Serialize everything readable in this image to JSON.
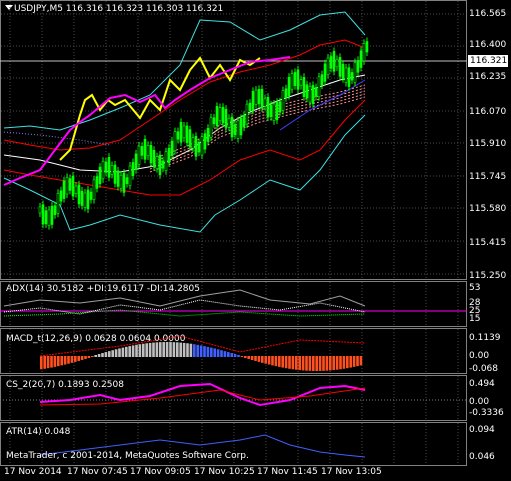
{
  "symbol_header": "USDJPY,M5  116.316 116.323 116.303 116.321",
  "current_price": "116.321",
  "price_axis": [
    "116.565",
    "116.400",
    "116.235",
    "116.070",
    "115.910",
    "115.745",
    "115.580",
    "115.415",
    "115.250"
  ],
  "adx": {
    "label": "ADX(14) 30.5182 +DI:19.6117 -DI:14.2805",
    "axis": [
      "53",
      "28",
      "25",
      "15"
    ]
  },
  "macd": {
    "label": "MACD_t(12,26,9) 0.0628 0.0604 0.0000",
    "axis": [
      "0.1139",
      "0.00",
      "-0.068"
    ]
  },
  "cs": {
    "label": "CS_2(20,7) 0.1893 0.2508",
    "axis": [
      "0.494",
      "0.00",
      "-0.3336"
    ]
  },
  "atr": {
    "label": "ATR(14) 0.048",
    "axis": [
      "0.094",
      "0.046"
    ],
    "copyright": "MetaTrader, c 2001-2014, MetaQuotes Software Corp."
  },
  "time_axis": [
    "17 Nov 2014",
    "17 Nov 07:45",
    "17 Nov 09:05",
    "17 Nov 10:25",
    "17 Nov 11:45",
    "17 Nov 13:05"
  ],
  "colors": {
    "up": "#00ff00",
    "down": "#00ff00",
    "yellow": "#ffff00",
    "magenta": "#ff00ff",
    "cyan": "#40e0e0",
    "red": "#ff0000"
  }
}
